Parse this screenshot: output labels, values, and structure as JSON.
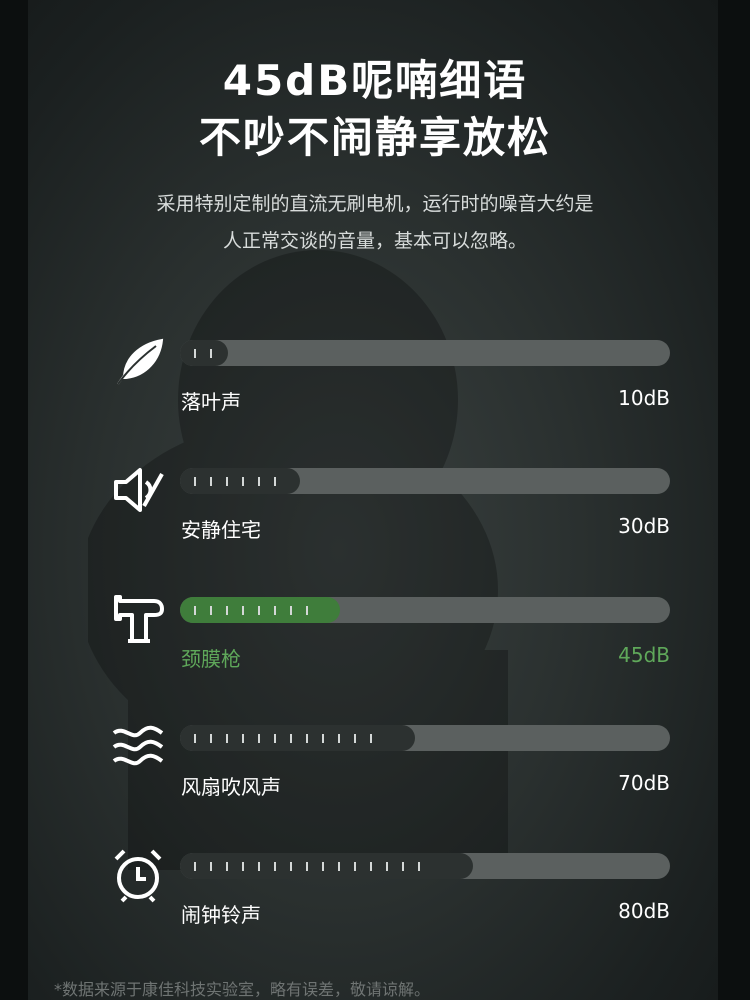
{
  "header": {
    "title_line1": "45dB呢喃细语",
    "title_line2": "不吵不闹静享放松",
    "desc_line1": "采用特别定制的直流无刷电机，运行时的噪音大约是",
    "desc_line2": "人正常交谈的音量，基本可以忽略。"
  },
  "levels": [
    {
      "icon": "leaf-icon",
      "label": "落叶声",
      "value": "10dB",
      "fill": 0.097,
      "ticks": 2,
      "highlight": false
    },
    {
      "icon": "speaker-mute-icon",
      "label": "安静住宅",
      "value": "30dB",
      "fill": 0.245,
      "ticks": 6,
      "highlight": false
    },
    {
      "icon": "massage-gun-icon",
      "label": "颈膜枪",
      "value": "45dB",
      "fill": 0.327,
      "ticks": 8,
      "highlight": true
    },
    {
      "icon": "wind-icon",
      "label": "风扇吹风声",
      "value": "70dB",
      "fill": 0.48,
      "ticks": 12,
      "highlight": false
    },
    {
      "icon": "alarm-clock-icon",
      "label": "闹钟铃声",
      "value": "80dB",
      "fill": 0.597,
      "ticks": 15,
      "highlight": false
    }
  ],
  "footnote": "*数据来源于康佳科技实验室，略有误差，敬请谅解。",
  "colors": {
    "highlight": "#5fa85a",
    "highlight_fill": "#3f7d3b",
    "track": "#5b605f",
    "fill": "#2c3130"
  }
}
